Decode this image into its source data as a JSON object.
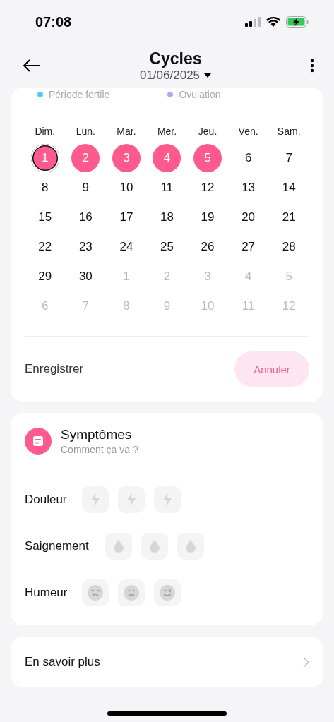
{
  "status_bar": {
    "time": "07:08"
  },
  "header": {
    "title": "Cycles",
    "date": "01/06/2025"
  },
  "legend": [
    {
      "label": "Période fertile",
      "color": "#5ac8fa"
    },
    {
      "label": "Ovulation",
      "color": "#b4a7f5"
    }
  ],
  "calendar": {
    "weekdays": [
      "Dim.",
      "Lun.",
      "Mar.",
      "Mer.",
      "Jeu.",
      "Ven.",
      "Sam."
    ],
    "days": [
      {
        "day": "1",
        "in_month": true,
        "period": true,
        "today": true
      },
      {
        "day": "2",
        "in_month": true,
        "period": true,
        "today": false
      },
      {
        "day": "3",
        "in_month": true,
        "period": true,
        "today": false
      },
      {
        "day": "4",
        "in_month": true,
        "period": true,
        "today": false
      },
      {
        "day": "5",
        "in_month": true,
        "period": true,
        "today": false
      },
      {
        "day": "6",
        "in_month": true,
        "period": false,
        "today": false
      },
      {
        "day": "7",
        "in_month": true,
        "period": false,
        "today": false
      },
      {
        "day": "8",
        "in_month": true,
        "period": false,
        "today": false
      },
      {
        "day": "9",
        "in_month": true,
        "period": false,
        "today": false
      },
      {
        "day": "10",
        "in_month": true,
        "period": false,
        "today": false
      },
      {
        "day": "11",
        "in_month": true,
        "period": false,
        "today": false
      },
      {
        "day": "12",
        "in_month": true,
        "period": false,
        "today": false
      },
      {
        "day": "13",
        "in_month": true,
        "period": false,
        "today": false
      },
      {
        "day": "14",
        "in_month": true,
        "period": false,
        "today": false
      },
      {
        "day": "15",
        "in_month": true,
        "period": false,
        "today": false
      },
      {
        "day": "16",
        "in_month": true,
        "period": false,
        "today": false
      },
      {
        "day": "17",
        "in_month": true,
        "period": false,
        "today": false
      },
      {
        "day": "18",
        "in_month": true,
        "period": false,
        "today": false
      },
      {
        "day": "19",
        "in_month": true,
        "period": false,
        "today": false
      },
      {
        "day": "20",
        "in_month": true,
        "period": false,
        "today": false
      },
      {
        "day": "21",
        "in_month": true,
        "period": false,
        "today": false
      },
      {
        "day": "22",
        "in_month": true,
        "period": false,
        "today": false
      },
      {
        "day": "23",
        "in_month": true,
        "period": false,
        "today": false
      },
      {
        "day": "24",
        "in_month": true,
        "period": false,
        "today": false
      },
      {
        "day": "25",
        "in_month": true,
        "period": false,
        "today": false
      },
      {
        "day": "26",
        "in_month": true,
        "period": false,
        "today": false
      },
      {
        "day": "27",
        "in_month": true,
        "period": false,
        "today": false
      },
      {
        "day": "28",
        "in_month": true,
        "period": false,
        "today": false
      },
      {
        "day": "29",
        "in_month": true,
        "period": false,
        "today": false
      },
      {
        "day": "30",
        "in_month": true,
        "period": false,
        "today": false
      },
      {
        "day": "1",
        "in_month": false,
        "period": false,
        "today": false
      },
      {
        "day": "2",
        "in_month": false,
        "period": false,
        "today": false
      },
      {
        "day": "3",
        "in_month": false,
        "period": false,
        "today": false
      },
      {
        "day": "4",
        "in_month": false,
        "period": false,
        "today": false
      },
      {
        "day": "5",
        "in_month": false,
        "period": false,
        "today": false
      },
      {
        "day": "6",
        "in_month": false,
        "period": false,
        "today": false
      },
      {
        "day": "7",
        "in_month": false,
        "period": false,
        "today": false
      },
      {
        "day": "8",
        "in_month": false,
        "period": false,
        "today": false
      },
      {
        "day": "9",
        "in_month": false,
        "period": false,
        "today": false
      },
      {
        "day": "10",
        "in_month": false,
        "period": false,
        "today": false
      },
      {
        "day": "11",
        "in_month": false,
        "period": false,
        "today": false
      },
      {
        "day": "12",
        "in_month": false,
        "period": false,
        "today": false
      }
    ]
  },
  "actions": {
    "save": "Enregistrer",
    "cancel": "Annuler"
  },
  "symptoms": {
    "title": "Symptômes",
    "subtitle": "Comment ça va ?",
    "rows": [
      {
        "label": "Douleur",
        "kind": "pain",
        "options": [
          {
            "selected": false
          },
          {
            "selected": false
          },
          {
            "selected": false
          }
        ]
      },
      {
        "label": "Saignement",
        "kind": "bleeding",
        "options": [
          {
            "selected": false
          },
          {
            "selected": false
          },
          {
            "selected": false
          }
        ]
      },
      {
        "label": "Humeur",
        "kind": "mood",
        "options": [
          {
            "selected": false
          },
          {
            "selected": false
          },
          {
            "selected": false
          }
        ]
      }
    ]
  },
  "more": {
    "label": "En savoir plus"
  }
}
